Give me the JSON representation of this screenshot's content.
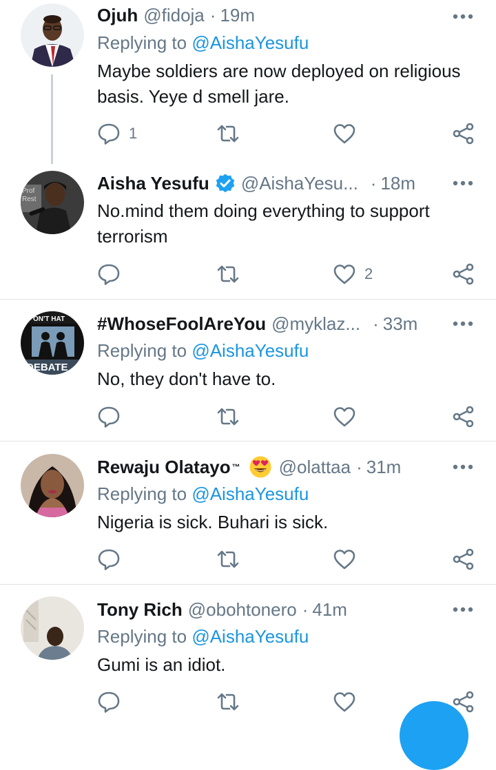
{
  "tweets": [
    {
      "name": "Ojuh",
      "handle": "@fidoja",
      "dot": "·",
      "time": "19m",
      "replying_prefix": "Replying to",
      "replying_to": "@AishaYesufu",
      "text": "Maybe soldiers are now deployed on religious basis. Yeye d smell jare.",
      "replies": "1",
      "likes": ""
    },
    {
      "name": "Aisha Yesufu",
      "handle": "@AishaYesu...",
      "dot": "·",
      "time": "18m",
      "text": "No.mind them doing everything to support terrorism",
      "replies": "",
      "likes": "2"
    },
    {
      "name": "#WhoseFoolAreYou",
      "handle": "@myklaz...",
      "dot": "·",
      "time": "33m",
      "replying_prefix": "Replying to",
      "replying_to": "@AishaYesufu",
      "text": "No, they don't have to.",
      "replies": "",
      "likes": "",
      "avatar_text_top": "ON'T HAT",
      "avatar_text_bottom": "DEBATE"
    },
    {
      "name": "Rewaju Olatayo",
      "name_mark": "™",
      "handle": "@olattaa",
      "dot": "·",
      "time": "31m",
      "replying_prefix": "Replying to",
      "replying_to": "@AishaYesufu",
      "text": "Nigeria is sick. Buhari is sick.",
      "replies": "",
      "likes": ""
    },
    {
      "name": "Tony Rich",
      "handle": "@obohtonero",
      "dot": "·",
      "time": "41m",
      "replying_prefix": "Replying to",
      "replying_to": "@AishaYesufu",
      "text": "Gumi is an idiot.",
      "replies": "",
      "likes": ""
    }
  ],
  "icons": {
    "reply": "reply-icon",
    "retweet": "retweet-icon",
    "like": "heart-icon",
    "share": "share-icon",
    "more": "more-icon",
    "verified": "verified-badge-icon",
    "emoji": "heart-eyes-emoji-icon"
  },
  "colors": {
    "link": "#1b95e0",
    "muted": "#657786",
    "text": "#14171a",
    "verified": "#1da1f2",
    "fab": "#1da1f2"
  }
}
